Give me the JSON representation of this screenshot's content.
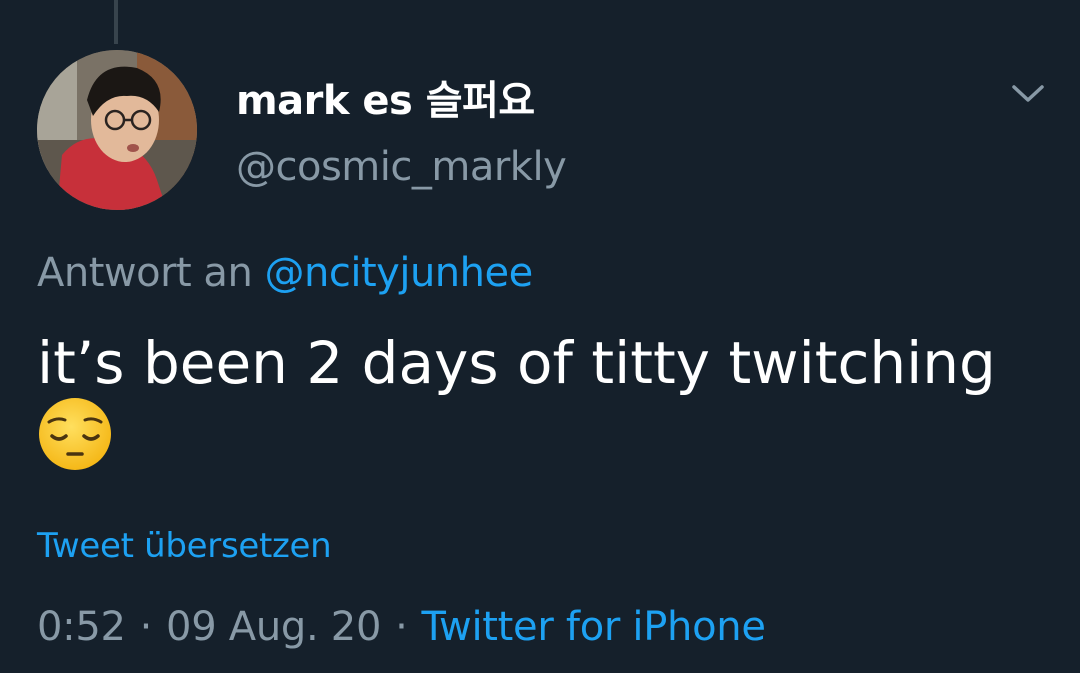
{
  "tweet": {
    "author": {
      "display_name": "mark es 슬퍼요",
      "handle": "@cosmic_markly"
    },
    "reply": {
      "prefix": "Antwort an",
      "mention": "@ncityjunhee"
    },
    "text": "it’s been 2 days of titty twitching",
    "emoji": "pensive-face",
    "translate_label": "Tweet übersetzen",
    "time": "0:52",
    "separator": "·",
    "date": "09 Aug. 20",
    "source": "Twitter for iPhone",
    "more_icon": "chevron-down-icon"
  },
  "colors": {
    "background": "#15202b",
    "primary_text": "#ffffff",
    "secondary_text": "#8899a6",
    "accent": "#1da1f2"
  }
}
